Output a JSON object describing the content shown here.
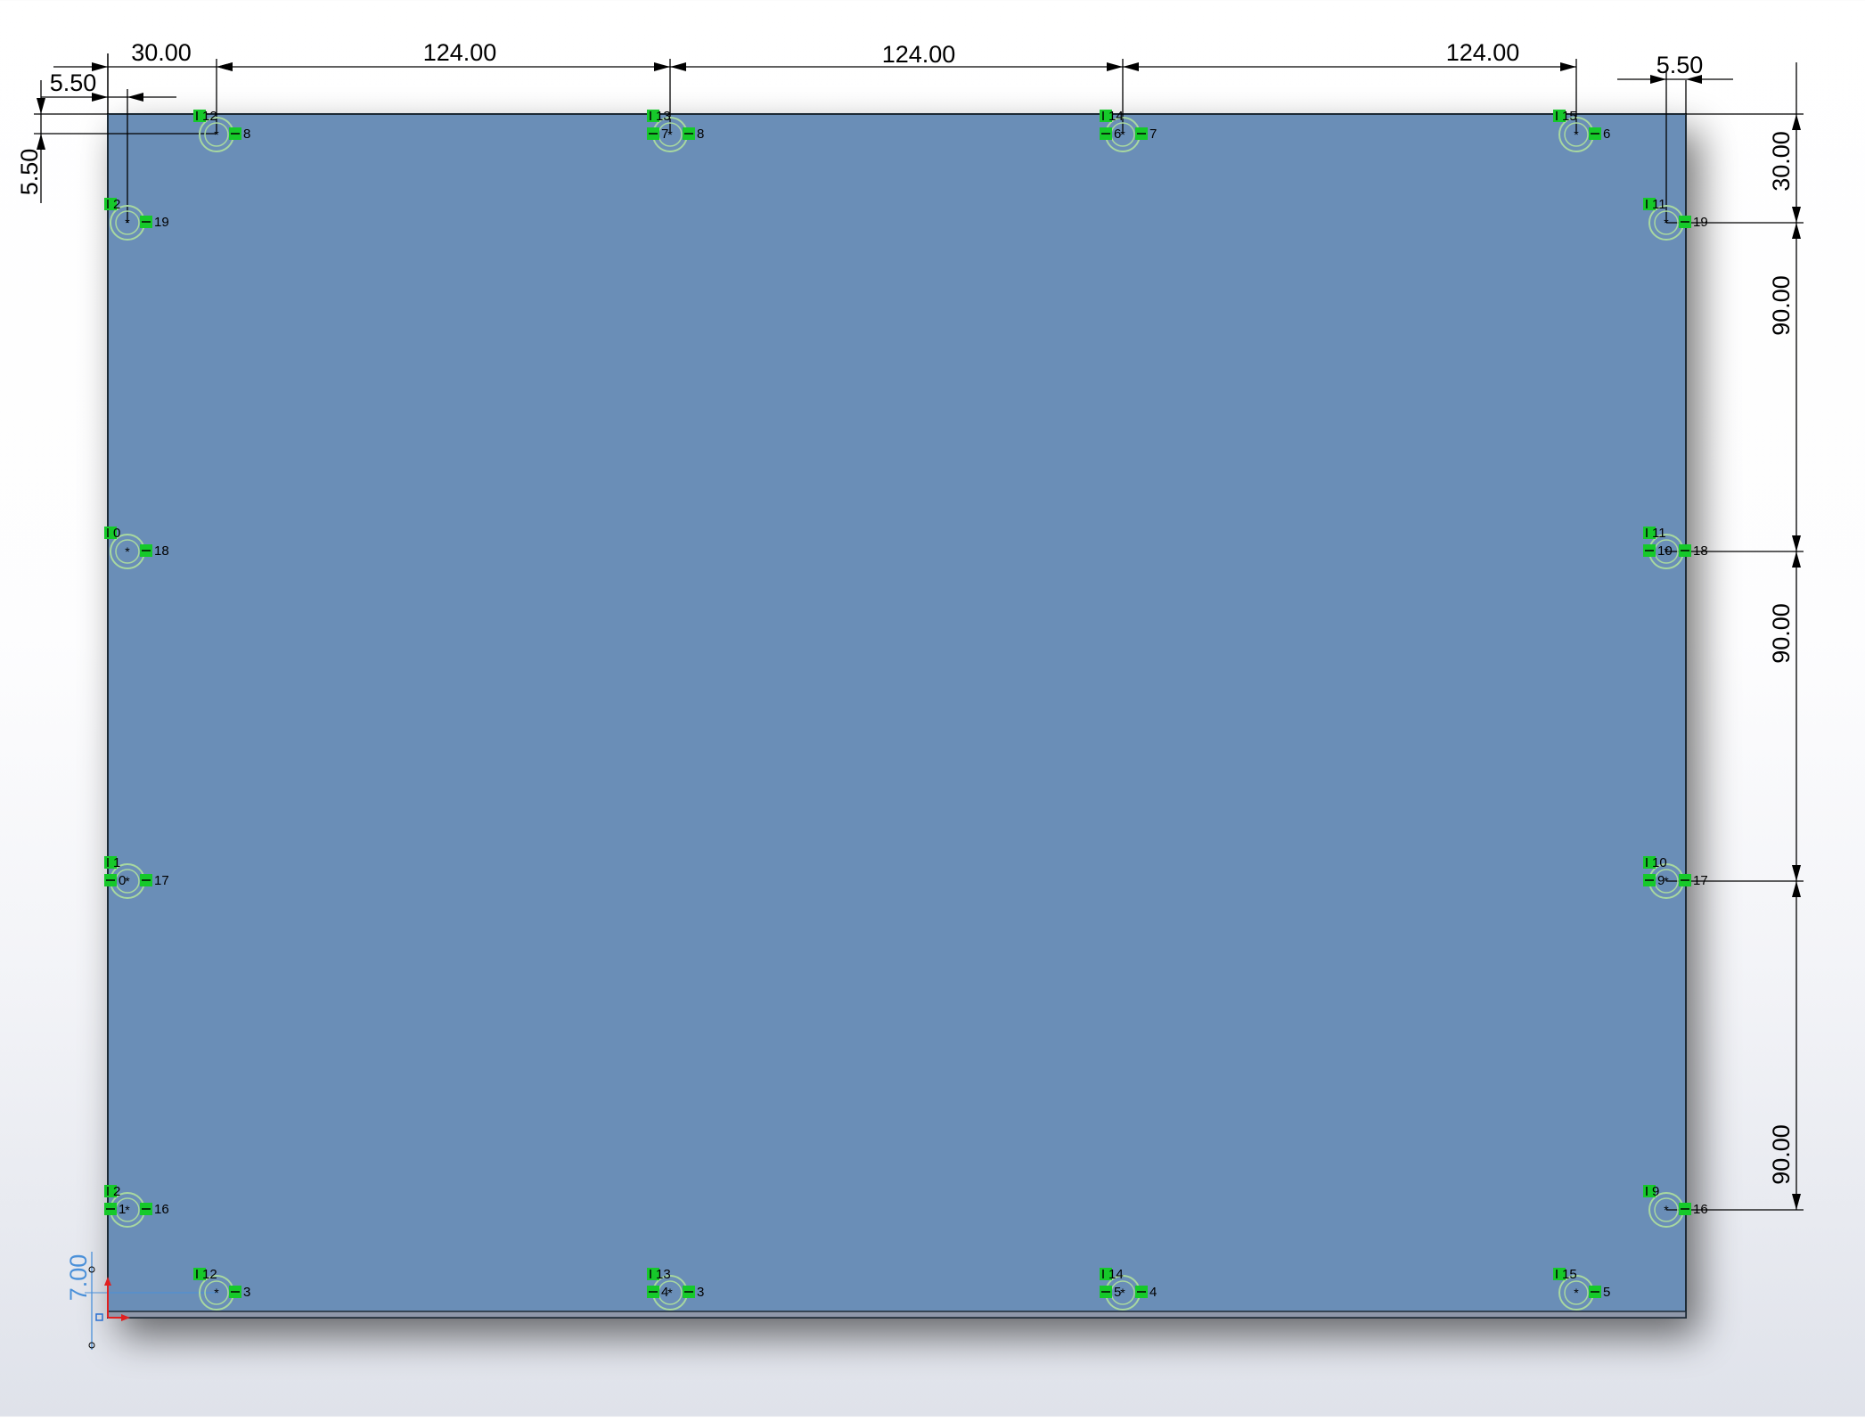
{
  "dimensions": {
    "top": [
      "30.00",
      "124.00",
      "124.00",
      "124.00"
    ],
    "top_left_offset": "5.50",
    "top_right_offset": "5.50",
    "left_offset": "5.50",
    "right": [
      "30.00",
      "90.00",
      "90.00",
      "90.00"
    ],
    "thickness": "7.00"
  },
  "colors": {
    "plate": "#6b8eb7",
    "plate_edge": "#1e2a36",
    "relation_badge": "#16c92a",
    "dimension": "#000000",
    "thickness_dimension": "#4a90d9",
    "hole_ring": "#a8d8a0",
    "origin_x": "#e02020",
    "origin_y": "#2a6fd0"
  },
  "holes": [
    {
      "id": "hole-top-1",
      "tags": [
        "12",
        "8"
      ]
    },
    {
      "id": "hole-top-2",
      "tags": [
        "13",
        "8",
        "7"
      ]
    },
    {
      "id": "hole-top-3",
      "tags": [
        "14",
        "7",
        "6"
      ]
    },
    {
      "id": "hole-top-4",
      "tags": [
        "15",
        "6"
      ]
    },
    {
      "id": "hole-left-1",
      "tags": [
        "2",
        "19"
      ]
    },
    {
      "id": "hole-left-2",
      "tags": [
        "0",
        "18"
      ]
    },
    {
      "id": "hole-left-3",
      "tags": [
        "1",
        "17",
        "0"
      ]
    },
    {
      "id": "hole-left-4",
      "tags": [
        "2",
        "16",
        "1"
      ]
    },
    {
      "id": "hole-right-1",
      "tags": [
        "11",
        "19"
      ]
    },
    {
      "id": "hole-right-2",
      "tags": [
        "11",
        "18",
        "10"
      ]
    },
    {
      "id": "hole-right-3",
      "tags": [
        "10",
        "17",
        "9"
      ]
    },
    {
      "id": "hole-right-4",
      "tags": [
        "9",
        "16"
      ]
    },
    {
      "id": "hole-bottom-1",
      "tags": [
        "12",
        "3"
      ]
    },
    {
      "id": "hole-bottom-2",
      "tags": [
        "13",
        "3",
        "4"
      ]
    },
    {
      "id": "hole-bottom-3",
      "tags": [
        "14",
        "4",
        "5"
      ]
    },
    {
      "id": "hole-bottom-4",
      "tags": [
        "15",
        "5"
      ]
    }
  ]
}
